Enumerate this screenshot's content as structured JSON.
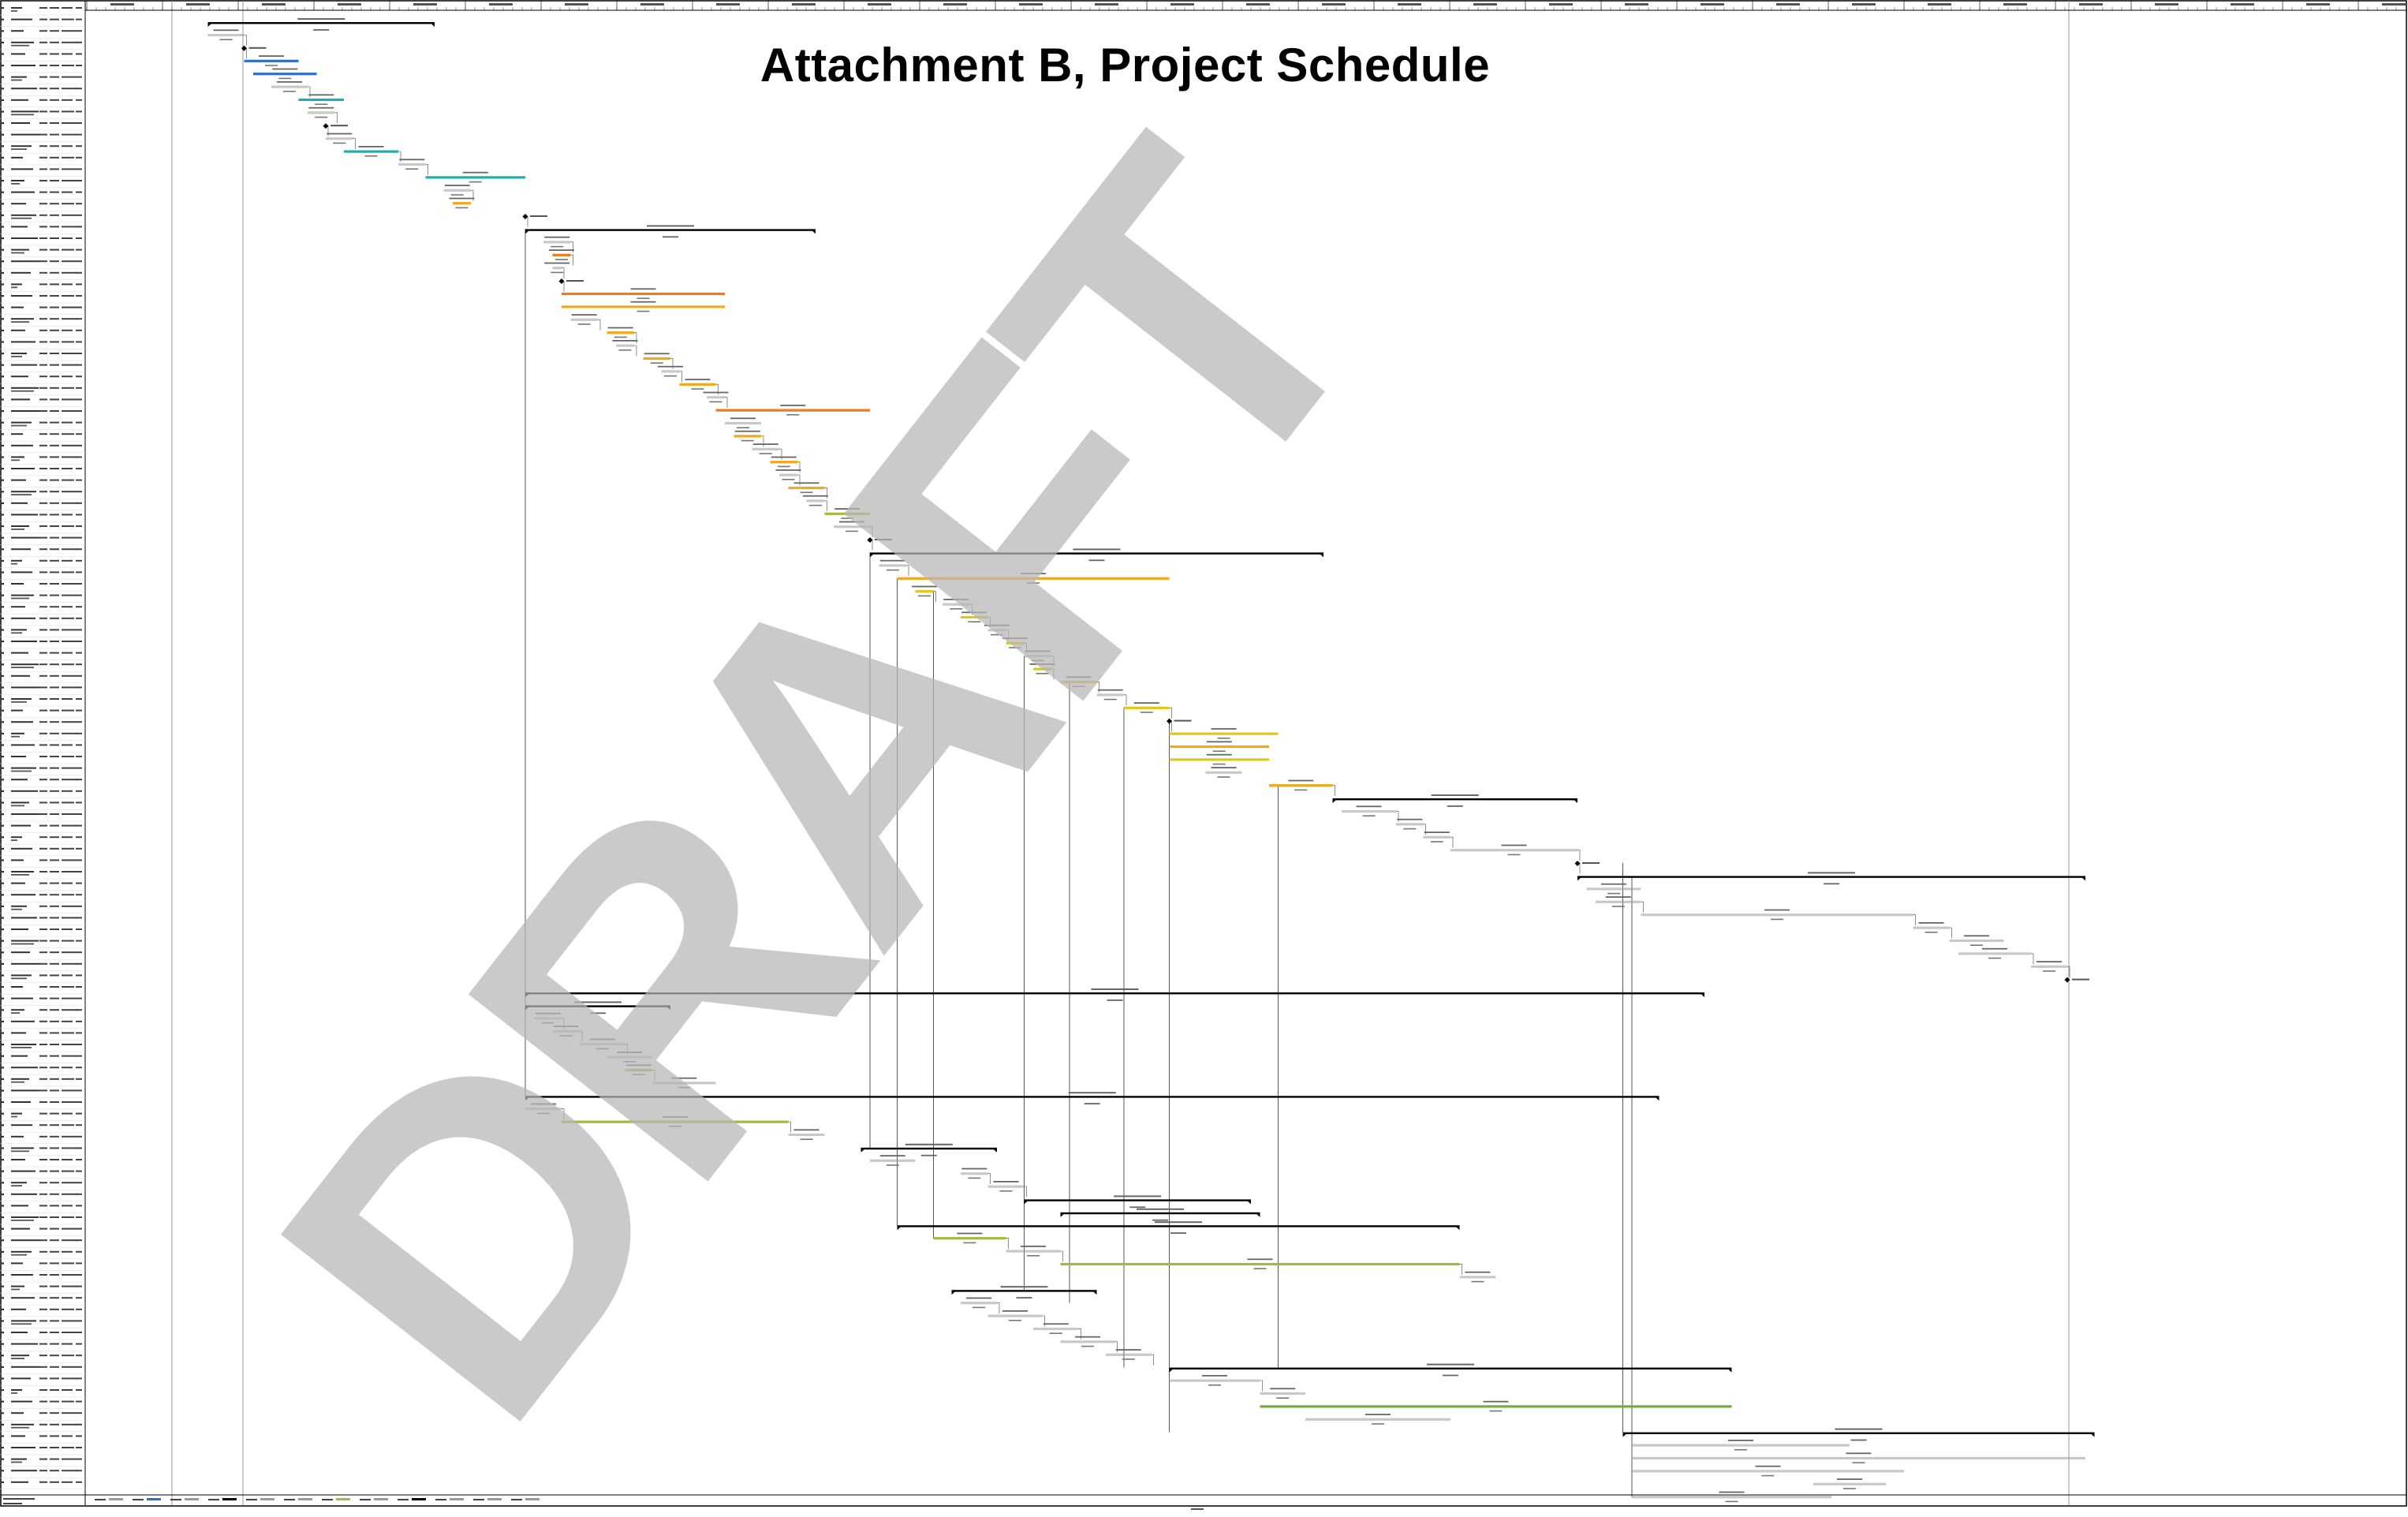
{
  "page": {
    "title": "Attachment B, Project Schedule",
    "watermark": "DRAFT"
  },
  "chart_data": {
    "type": "gantt",
    "title": "Attachment B, Project Schedule",
    "grid": true,
    "legend": "none",
    "colors": {
      "summary": "#000000",
      "blue": "#2f6fd0",
      "cyan": "#19b0b0",
      "orange": "#f07a1e",
      "amber": "#f2a81c",
      "yellow": "#e2c814",
      "olive": "#a8b83a",
      "green": "#6fae3c",
      "gray": "#9a9a9a",
      "link": "#444444",
      "watermark": "#b7b7b7"
    },
    "columns": [
      "Task",
      "Mode",
      "Duration",
      "Start",
      "Finish"
    ],
    "tasks": [
      {
        "id": 1,
        "start": 9,
        "dur": 25,
        "type": "summary"
      },
      {
        "id": 2,
        "start": 9,
        "dur": 4,
        "type": "task",
        "color": "gray"
      },
      {
        "id": 3,
        "start": 13,
        "dur": 0,
        "type": "milestone"
      },
      {
        "id": 4,
        "start": 13,
        "dur": 6,
        "type": "task",
        "color": "blue"
      },
      {
        "id": 5,
        "start": 14,
        "dur": 7,
        "type": "task",
        "color": "blue"
      },
      {
        "id": 6,
        "start": 16,
        "dur": 4,
        "type": "task",
        "color": "gray"
      },
      {
        "id": 7,
        "start": 19,
        "dur": 5,
        "type": "task",
        "color": "cyan"
      },
      {
        "id": 8,
        "start": 20,
        "dur": 3,
        "type": "task",
        "color": "gray"
      },
      {
        "id": 9,
        "start": 22,
        "dur": 0,
        "type": "milestone"
      },
      {
        "id": 10,
        "start": 22,
        "dur": 3,
        "type": "task",
        "color": "gray"
      },
      {
        "id": 11,
        "start": 24,
        "dur": 6,
        "type": "task",
        "color": "cyan"
      },
      {
        "id": 12,
        "start": 30,
        "dur": 3,
        "type": "task",
        "color": "gray"
      },
      {
        "id": 13,
        "start": 33,
        "dur": 11,
        "type": "task",
        "color": "cyan"
      },
      {
        "id": 14,
        "start": 35,
        "dur": 3,
        "type": "task",
        "color": "gray"
      },
      {
        "id": 15,
        "start": 36,
        "dur": 2,
        "type": "task",
        "color": "amber"
      },
      {
        "id": 16,
        "start": 44,
        "dur": 0,
        "type": "milestone"
      },
      {
        "id": 17,
        "start": 44,
        "dur": 32,
        "type": "summary"
      },
      {
        "id": 18,
        "start": 46,
        "dur": 3,
        "type": "task",
        "color": "gray"
      },
      {
        "id": 19,
        "start": 47,
        "dur": 2,
        "type": "task",
        "color": "orange"
      },
      {
        "id": 20,
        "start": 47,
        "dur": 1,
        "type": "task",
        "color": "gray"
      },
      {
        "id": 21,
        "start": 48,
        "dur": 0,
        "type": "milestone"
      },
      {
        "id": 22,
        "start": 48,
        "dur": 18,
        "type": "task",
        "color": "orange"
      },
      {
        "id": 23,
        "start": 48,
        "dur": 18,
        "type": "task",
        "color": "amber"
      },
      {
        "id": 24,
        "start": 49,
        "dur": 3,
        "type": "task",
        "color": "gray"
      },
      {
        "id": 25,
        "start": 53,
        "dur": 3,
        "type": "task",
        "color": "amber"
      },
      {
        "id": 26,
        "start": 54,
        "dur": 2,
        "type": "task",
        "color": "gray"
      },
      {
        "id": 27,
        "start": 57,
        "dur": 3,
        "type": "task",
        "color": "amber"
      },
      {
        "id": 28,
        "start": 59,
        "dur": 2,
        "type": "task",
        "color": "gray"
      },
      {
        "id": 29,
        "start": 61,
        "dur": 4,
        "type": "task",
        "color": "amber"
      },
      {
        "id": 30,
        "start": 64,
        "dur": 2,
        "type": "task",
        "color": "gray"
      },
      {
        "id": 31,
        "start": 65,
        "dur": 17,
        "type": "task",
        "color": "orange"
      },
      {
        "id": 32,
        "start": 66,
        "dur": 4,
        "type": "task",
        "color": "gray"
      },
      {
        "id": 33,
        "start": 67,
        "dur": 3,
        "type": "task",
        "color": "amber"
      },
      {
        "id": 34,
        "start": 69,
        "dur": 3,
        "type": "task",
        "color": "gray"
      },
      {
        "id": 35,
        "start": 71,
        "dur": 3,
        "type": "task",
        "color": "amber"
      },
      {
        "id": 36,
        "start": 72,
        "dur": 2,
        "type": "task",
        "color": "gray"
      },
      {
        "id": 37,
        "start": 73,
        "dur": 4,
        "type": "task",
        "color": "amber"
      },
      {
        "id": 38,
        "start": 75,
        "dur": 2,
        "type": "task",
        "color": "gray"
      },
      {
        "id": 39,
        "start": 77,
        "dur": 5,
        "type": "task",
        "color": "olive"
      },
      {
        "id": 40,
        "start": 78,
        "dur": 4,
        "type": "task",
        "color": "gray"
      },
      {
        "id": 41,
        "start": 82,
        "dur": 0,
        "type": "milestone"
      },
      {
        "id": 42,
        "start": 82,
        "dur": 50,
        "type": "summary"
      },
      {
        "id": 43,
        "start": 83,
        "dur": 3,
        "type": "task",
        "color": "gray"
      },
      {
        "id": 44,
        "start": 85,
        "dur": 30,
        "type": "task",
        "color": "amber"
      },
      {
        "id": 45,
        "start": 87,
        "dur": 2,
        "type": "task",
        "color": "yellow"
      },
      {
        "id": 46,
        "start": 90,
        "dur": 3,
        "type": "task",
        "color": "gray"
      },
      {
        "id": 47,
        "start": 92,
        "dur": 3,
        "type": "task",
        "color": "yellow"
      },
      {
        "id": 48,
        "start": 95,
        "dur": 2,
        "type": "task",
        "color": "gray"
      },
      {
        "id": 49,
        "start": 97,
        "dur": 2,
        "type": "task",
        "color": "yellow"
      },
      {
        "id": 50,
        "start": 99,
        "dur": 3,
        "type": "task",
        "color": "gray"
      },
      {
        "id": 51,
        "start": 100,
        "dur": 2,
        "type": "task",
        "color": "yellow"
      },
      {
        "id": 52,
        "start": 103,
        "dur": 4,
        "type": "task",
        "color": "yellow"
      },
      {
        "id": 53,
        "start": 107,
        "dur": 3,
        "type": "task",
        "color": "gray"
      },
      {
        "id": 54,
        "start": 110,
        "dur": 5,
        "type": "task",
        "color": "yellow"
      },
      {
        "id": 55,
        "start": 115,
        "dur": 0,
        "type": "milestone"
      },
      {
        "id": 56,
        "start": 115,
        "dur": 12,
        "type": "task",
        "color": "yellow"
      },
      {
        "id": 57,
        "start": 115,
        "dur": 11,
        "type": "task",
        "color": "amber"
      },
      {
        "id": 58,
        "start": 115,
        "dur": 11,
        "type": "task",
        "color": "yellow"
      },
      {
        "id": 59,
        "start": 119,
        "dur": 4,
        "type": "task",
        "color": "gray"
      },
      {
        "id": 60,
        "start": 126,
        "dur": 7,
        "type": "task",
        "color": "amber"
      },
      {
        "id": 61,
        "start": 133,
        "dur": 27,
        "type": "summary"
      },
      {
        "id": 62,
        "start": 134,
        "dur": 6,
        "type": "task",
        "color": "gray"
      },
      {
        "id": 63,
        "start": 140,
        "dur": 3,
        "type": "task",
        "color": "gray"
      },
      {
        "id": 64,
        "start": 143,
        "dur": 3,
        "type": "task",
        "color": "gray"
      },
      {
        "id": 65,
        "start": 146,
        "dur": 14,
        "type": "task",
        "color": "gray"
      },
      {
        "id": 66,
        "start": 160,
        "dur": 0,
        "type": "milestone"
      },
      {
        "id": 67,
        "start": 160,
        "dur": 56,
        "type": "summary"
      },
      {
        "id": 68,
        "start": 161,
        "dur": 6,
        "type": "task",
        "color": "gray"
      },
      {
        "id": 69,
        "start": 162,
        "dur": 5,
        "type": "task",
        "color": "gray"
      },
      {
        "id": 70,
        "start": 167,
        "dur": 30,
        "type": "task",
        "color": "gray"
      },
      {
        "id": 71,
        "start": 197,
        "dur": 4,
        "type": "task",
        "color": "gray"
      },
      {
        "id": 72,
        "start": 201,
        "dur": 6,
        "type": "task",
        "color": "gray"
      },
      {
        "id": 73,
        "start": 202,
        "dur": 8,
        "type": "task",
        "color": "gray"
      },
      {
        "id": 74,
        "start": 210,
        "dur": 4,
        "type": "task",
        "color": "gray"
      },
      {
        "id": 75,
        "start": 214,
        "dur": 0,
        "type": "milestone"
      },
      {
        "id": 76,
        "start": 44,
        "dur": 130,
        "type": "summary"
      },
      {
        "id": 77,
        "start": 44,
        "dur": 16,
        "type": "summary"
      },
      {
        "id": 78,
        "start": 45,
        "dur": 3,
        "type": "task",
        "color": "gray"
      },
      {
        "id": 79,
        "start": 47,
        "dur": 3,
        "type": "task",
        "color": "gray"
      },
      {
        "id": 80,
        "start": 50,
        "dur": 5,
        "type": "task",
        "color": "gray"
      },
      {
        "id": 81,
        "start": 53,
        "dur": 5,
        "type": "task",
        "color": "gray"
      },
      {
        "id": 82,
        "start": 55,
        "dur": 3,
        "type": "task",
        "color": "olive"
      },
      {
        "id": 83,
        "start": 58,
        "dur": 7,
        "type": "task",
        "color": "gray"
      },
      {
        "id": 84,
        "start": 44,
        "dur": 125,
        "type": "summary"
      },
      {
        "id": 85,
        "start": 44,
        "dur": 4,
        "type": "task",
        "color": "gray"
      },
      {
        "id": 86,
        "start": 48,
        "dur": 25,
        "type": "task",
        "color": "olive"
      },
      {
        "id": 87,
        "start": 73,
        "dur": 4,
        "type": "task",
        "color": "gray"
      },
      {
        "id": 88,
        "start": 81,
        "dur": 15,
        "type": "summary"
      },
      {
        "id": 89,
        "start": 82,
        "dur": 5,
        "type": "task",
        "color": "gray"
      },
      {
        "id": 90,
        "start": 92,
        "dur": 3,
        "type": "task",
        "color": "gray"
      },
      {
        "id": 91,
        "start": 95,
        "dur": 4,
        "type": "task",
        "color": "gray"
      },
      {
        "id": 92,
        "start": 99,
        "dur": 25,
        "type": "summary"
      },
      {
        "id": 93,
        "start": 103,
        "dur": 22,
        "type": "summary"
      },
      {
        "id": 94,
        "start": 85,
        "dur": 62,
        "type": "summary"
      },
      {
        "id": 95,
        "start": 89,
        "dur": 8,
        "type": "task",
        "color": "olive"
      },
      {
        "id": 96,
        "start": 97,
        "dur": 6,
        "type": "task",
        "color": "gray"
      },
      {
        "id": 97,
        "start": 103,
        "dur": 44,
        "type": "task",
        "color": "olive"
      },
      {
        "id": 98,
        "start": 147,
        "dur": 4,
        "type": "task",
        "color": "gray"
      },
      {
        "id": 99,
        "start": 91,
        "dur": 16,
        "type": "summary"
      },
      {
        "id": 100,
        "start": 92,
        "dur": 4,
        "type": "task",
        "color": "gray"
      },
      {
        "id": 101,
        "start": 95,
        "dur": 6,
        "type": "task",
        "color": "gray"
      },
      {
        "id": 102,
        "start": 100,
        "dur": 5,
        "type": "task",
        "color": "gray"
      },
      {
        "id": 103,
        "start": 103,
        "dur": 6,
        "type": "task",
        "color": "gray"
      },
      {
        "id": 104,
        "start": 108,
        "dur": 5,
        "type": "task",
        "color": "gray"
      },
      {
        "id": 105,
        "start": 115,
        "dur": 62,
        "type": "summary"
      },
      {
        "id": 106,
        "start": 115,
        "dur": 10,
        "type": "task",
        "color": "gray"
      },
      {
        "id": 107,
        "start": 125,
        "dur": 5,
        "type": "task",
        "color": "gray"
      },
      {
        "id": 108,
        "start": 125,
        "dur": 52,
        "type": "task",
        "color": "green"
      },
      {
        "id": 109,
        "start": 130,
        "dur": 16,
        "type": "task",
        "color": "gray"
      },
      {
        "id": 110,
        "start": 165,
        "dur": 52,
        "type": "summary"
      },
      {
        "id": 111,
        "start": 166,
        "dur": 24,
        "type": "task",
        "color": "gray"
      },
      {
        "id": 112,
        "start": 166,
        "dur": 50,
        "type": "task",
        "color": "gray"
      },
      {
        "id": 113,
        "start": 166,
        "dur": 30,
        "type": "task",
        "color": "gray"
      },
      {
        "id": 114,
        "start": 186,
        "dur": 8,
        "type": "task",
        "color": "gray"
      },
      {
        "id": 115,
        "start": 166,
        "dur": 22,
        "type": "task",
        "color": "gray"
      }
    ]
  }
}
